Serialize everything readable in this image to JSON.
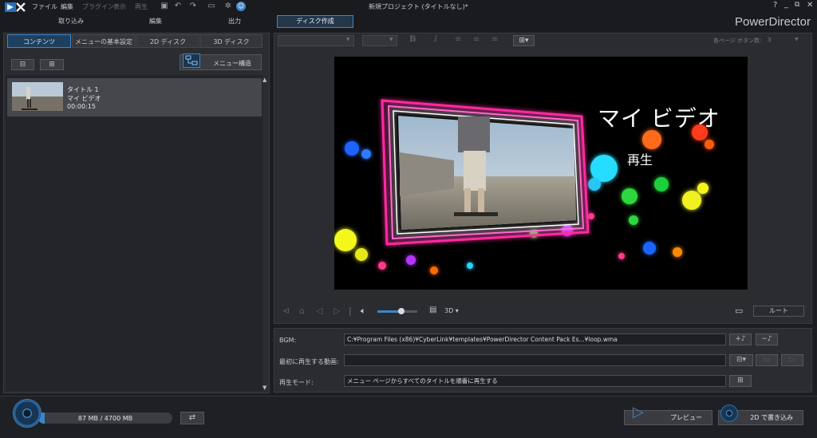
{
  "menu": {
    "file": "ファイル",
    "edit": "編集",
    "plugins": "プラグイン",
    "view": "表示",
    "play": "再生"
  },
  "window": {
    "title": "新規プロジェクト (タイトルなし)*",
    "brand": "PowerDirector",
    "help": "?"
  },
  "modes": {
    "capture": "取り込み",
    "edit": "編集",
    "produce": "出力",
    "disc": "ディスク作成"
  },
  "left_tabs": {
    "content": "コンテンツ",
    "menu_settings": "メニューの基本設定",
    "disc_2d": "2D ディスク",
    "disc_3d": "3D ディスク"
  },
  "menu_structure": "メニュー構造",
  "content_items": [
    {
      "title": "タイトル 1",
      "name": "マイ ビデオ",
      "duration": "00:00:15"
    }
  ],
  "editor": {
    "buttons_per_page_label": "各ページ ボタン数:",
    "buttons_per_page_value": "3"
  },
  "preview": {
    "menu_title": "マイ ビデオ",
    "play_button": "再生"
  },
  "transport": {
    "mode_3d": "3D",
    "volume": 0.6,
    "root_label": "ルート"
  },
  "props": {
    "bgm_label": "BGM:",
    "bgm_value": "C:¥Program Files (x86)¥CyberLink¥templates¥PowerDirector Content Pack Es...¥loop.wma",
    "first_play_label": "最初に再生する動画:",
    "first_play_value": "",
    "play_mode_label": "再生モード:",
    "play_mode_value": "メニュー ページからすべてのタイトルを順番に再生する"
  },
  "capacity": {
    "text": "87 MB / 4700 MB",
    "used_fraction": 0.0185
  },
  "bottom": {
    "preview": "プレビュー",
    "burn_2d": "2D で書き込み"
  },
  "colors": {
    "accent": "#3c86c9",
    "background": "#1c1d20",
    "panel": "#2b2c30"
  }
}
